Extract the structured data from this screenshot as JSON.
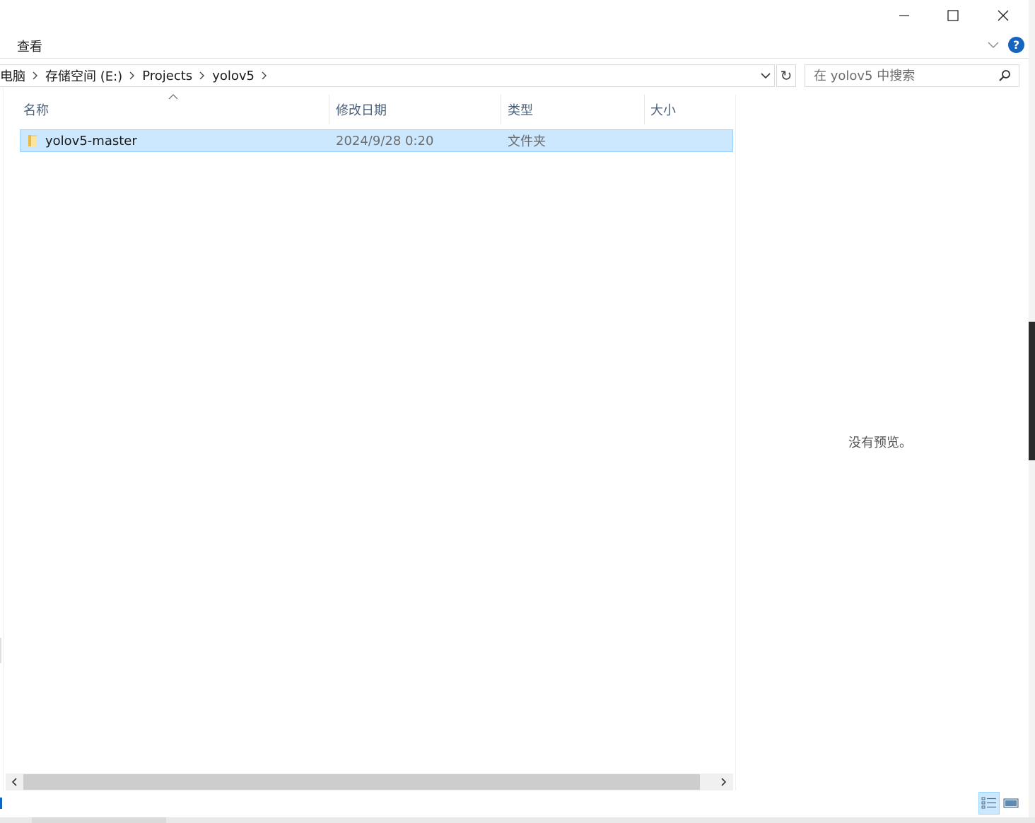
{
  "window": {
    "minimize_icon": "minimize-icon",
    "maximize_icon": "maximize-icon",
    "close_icon": "close-icon"
  },
  "ribbon": {
    "tab_view": "查看",
    "help_label": "?"
  },
  "address": {
    "crumbs": [
      "电脑",
      "存储空间 (E:)",
      "Projects",
      "yolov5"
    ],
    "refresh_symbol": "↻"
  },
  "search": {
    "placeholder": "在 yolov5 中搜索"
  },
  "columns": {
    "name": "名称",
    "modified": "修改日期",
    "type": "类型",
    "size": "大小"
  },
  "files": [
    {
      "name": "yolov5-master",
      "modified": "2024/9/28 0:20",
      "type": "文件夹",
      "size": ""
    }
  ],
  "preview": {
    "empty_text": "没有预览。"
  },
  "colors": {
    "selection": "#cce8ff",
    "selection_border": "#99d1ff",
    "accent": "#1565c0",
    "header_text": "#4c607a"
  }
}
